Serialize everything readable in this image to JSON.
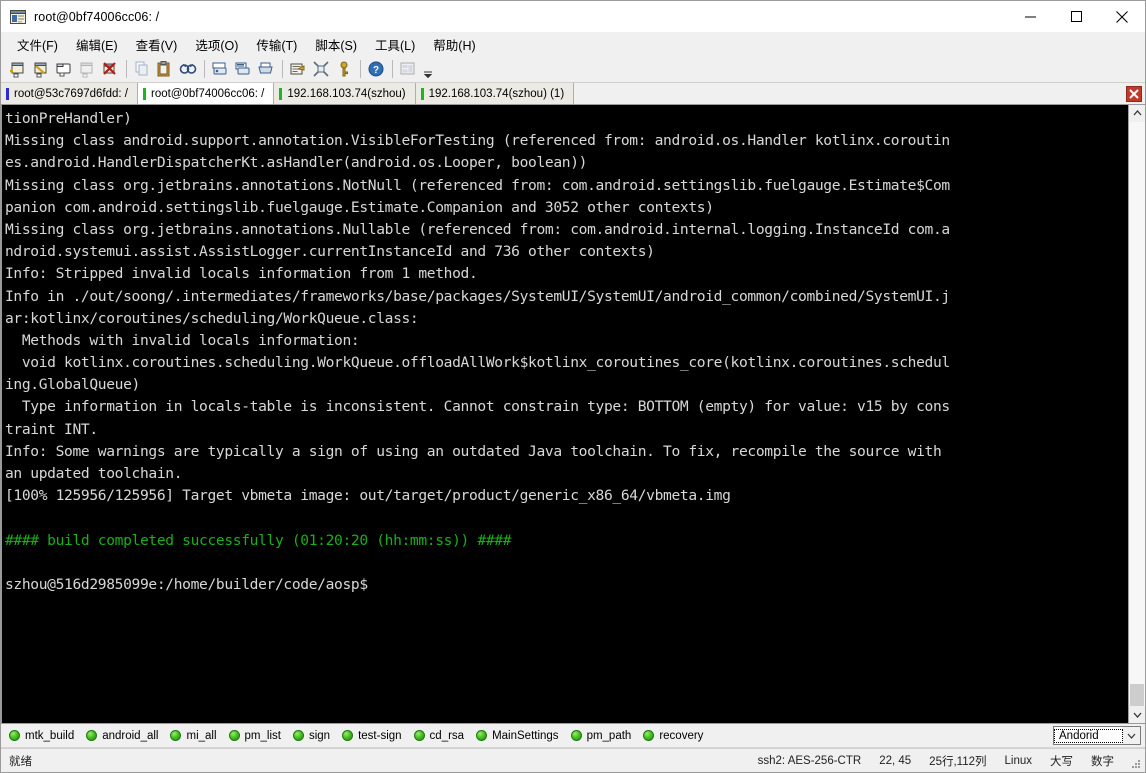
{
  "window": {
    "title": "root@0bf74006cc06: /",
    "icon": "terminal-app-icon",
    "minimize_label": "—",
    "maximize_label": "☐",
    "close_label": "✕"
  },
  "menubar": {
    "items": [
      {
        "label": "文件(F)",
        "name": "menu-file"
      },
      {
        "label": "编辑(E)",
        "name": "menu-edit"
      },
      {
        "label": "查看(V)",
        "name": "menu-view"
      },
      {
        "label": "选项(O)",
        "name": "menu-options"
      },
      {
        "label": "传输(T)",
        "name": "menu-transfer"
      },
      {
        "label": "脚本(S)",
        "name": "menu-script"
      },
      {
        "label": "工具(L)",
        "name": "menu-tools"
      },
      {
        "label": "帮助(H)",
        "name": "menu-help"
      }
    ]
  },
  "toolbar": {
    "buttons": [
      {
        "name": "new-session-icon",
        "glyph": "▤"
      },
      {
        "name": "connect-sftp-icon",
        "glyph": "▥"
      },
      {
        "name": "new-tab-icon",
        "glyph": "▦"
      },
      {
        "name": "reconnect-icon",
        "glyph": "▧"
      },
      {
        "name": "disconnect-icon",
        "glyph": "✗"
      },
      {
        "name": "copy-icon",
        "glyph": "⧉"
      },
      {
        "name": "paste-icon",
        "glyph": "Ὄb"
      },
      {
        "name": "find-icon",
        "glyph": "♆"
      },
      {
        "name": "print-screen-icon",
        "glyph": "⎙"
      },
      {
        "name": "log-session-icon",
        "glyph": "⎓"
      },
      {
        "name": "print-icon",
        "glyph": "⎙"
      },
      {
        "name": "session-options-icon",
        "glyph": "✎"
      },
      {
        "name": "settings-icon",
        "glyph": "✕"
      },
      {
        "name": "key-icon",
        "glyph": "⚷"
      },
      {
        "name": "help-icon",
        "glyph": "?"
      },
      {
        "name": "arrange-icon",
        "glyph": "▣"
      }
    ],
    "overflow_label": "▾"
  },
  "tabs": {
    "items": [
      {
        "label": "root@53c7697d6fdd: /",
        "active": false,
        "mark": "blue"
      },
      {
        "label": "root@0bf74006cc06: /",
        "active": true,
        "mark": "green"
      },
      {
        "label": "192.168.103.74(szhou)",
        "active": false,
        "mark": "green"
      },
      {
        "label": "192.168.103.74(szhou) (1)",
        "active": false,
        "mark": "green"
      }
    ],
    "close_label": "✖"
  },
  "terminal": {
    "scroll_up_label": "ⱏ",
    "scroll_down_label": "ⱞ",
    "lines": [
      {
        "text": "tionPreHandler)",
        "color": "normal"
      },
      {
        "text": "Missing class android.support.annotation.VisibleForTesting (referenced from: android.os.Handler kotlinx.coroutin",
        "color": "normal"
      },
      {
        "text": "es.android.HandlerDispatcherKt.asHandler(android.os.Looper, boolean))",
        "color": "normal"
      },
      {
        "text": "Missing class org.jetbrains.annotations.NotNull (referenced from: com.android.settingslib.fuelgauge.Estimate$Com",
        "color": "normal"
      },
      {
        "text": "panion com.android.settingslib.fuelgauge.Estimate.Companion and 3052 other contexts)",
        "color": "normal"
      },
      {
        "text": "Missing class org.jetbrains.annotations.Nullable (referenced from: com.android.internal.logging.InstanceId com.a",
        "color": "normal"
      },
      {
        "text": "ndroid.systemui.assist.AssistLogger.currentInstanceId and 736 other contexts)",
        "color": "normal"
      },
      {
        "text": "Info: Stripped invalid locals information from 1 method.",
        "color": "normal"
      },
      {
        "text": "Info in ./out/soong/.intermediates/frameworks/base/packages/SystemUI/SystemUI/android_common/combined/SystemUI.j",
        "color": "normal"
      },
      {
        "text": "ar:kotlinx/coroutines/scheduling/WorkQueue.class:",
        "color": "normal"
      },
      {
        "text": "  Methods with invalid locals information:",
        "color": "normal"
      },
      {
        "text": "  void kotlinx.coroutines.scheduling.WorkQueue.offloadAllWork$kotlinx_coroutines_core(kotlinx.coroutines.schedul",
        "color": "normal"
      },
      {
        "text": "ing.GlobalQueue)",
        "color": "normal"
      },
      {
        "text": "  Type information in locals-table is inconsistent. Cannot constrain type: BOTTOM (empty) for value: v15 by cons",
        "color": "normal"
      },
      {
        "text": "traint INT.",
        "color": "normal"
      },
      {
        "text": "Info: Some warnings are typically a sign of using an outdated Java toolchain. To fix, recompile the source with",
        "color": "normal"
      },
      {
        "text": "an updated toolchain.",
        "color": "normal"
      },
      {
        "text": "[100% 125956/125956] Target vbmeta image: out/target/product/generic_x86_64/vbmeta.img",
        "color": "normal"
      },
      {
        "text": "",
        "color": "normal"
      },
      {
        "text": "#### build completed successfully (01:20:20 (hh:mm:ss)) ####",
        "color": "green"
      },
      {
        "text": "",
        "color": "normal"
      },
      {
        "text": "szhou@516d2985099e:/home/builder/code/aosp$",
        "color": "normal"
      }
    ]
  },
  "buttonbar": {
    "items": [
      {
        "label": "mtk_build",
        "name": "button-mtk-build"
      },
      {
        "label": "android_all",
        "name": "button-android-all"
      },
      {
        "label": "mi_all",
        "name": "button-mi-all"
      },
      {
        "label": "pm_list",
        "name": "button-pm-list"
      },
      {
        "label": "sign",
        "name": "button-sign"
      },
      {
        "label": "test-sign",
        "name": "button-test-sign"
      },
      {
        "label": "cd_rsa",
        "name": "button-cd-rsa"
      },
      {
        "label": "MainSettings",
        "name": "button-mainsettings"
      },
      {
        "label": "pm_path",
        "name": "button-pm-path"
      },
      {
        "label": "recovery",
        "name": "button-recovery"
      }
    ],
    "selected_set": "Andorid",
    "dropdown_arrow": "⌄"
  },
  "statusbar": {
    "left": "就绪",
    "cells": [
      "ssh2: AES-256-CTR",
      "22, 45",
      "25行,112列",
      "Linux",
      "大写",
      "数字"
    ]
  },
  "colors": {
    "terminal_bg": "#000000",
    "terminal_fg": "#d8d8d8",
    "success_green": "#18b018",
    "chrome_bg": "#f0f0f0",
    "tab_active_bg": "#ffffff",
    "close_red": "#c0392b"
  }
}
